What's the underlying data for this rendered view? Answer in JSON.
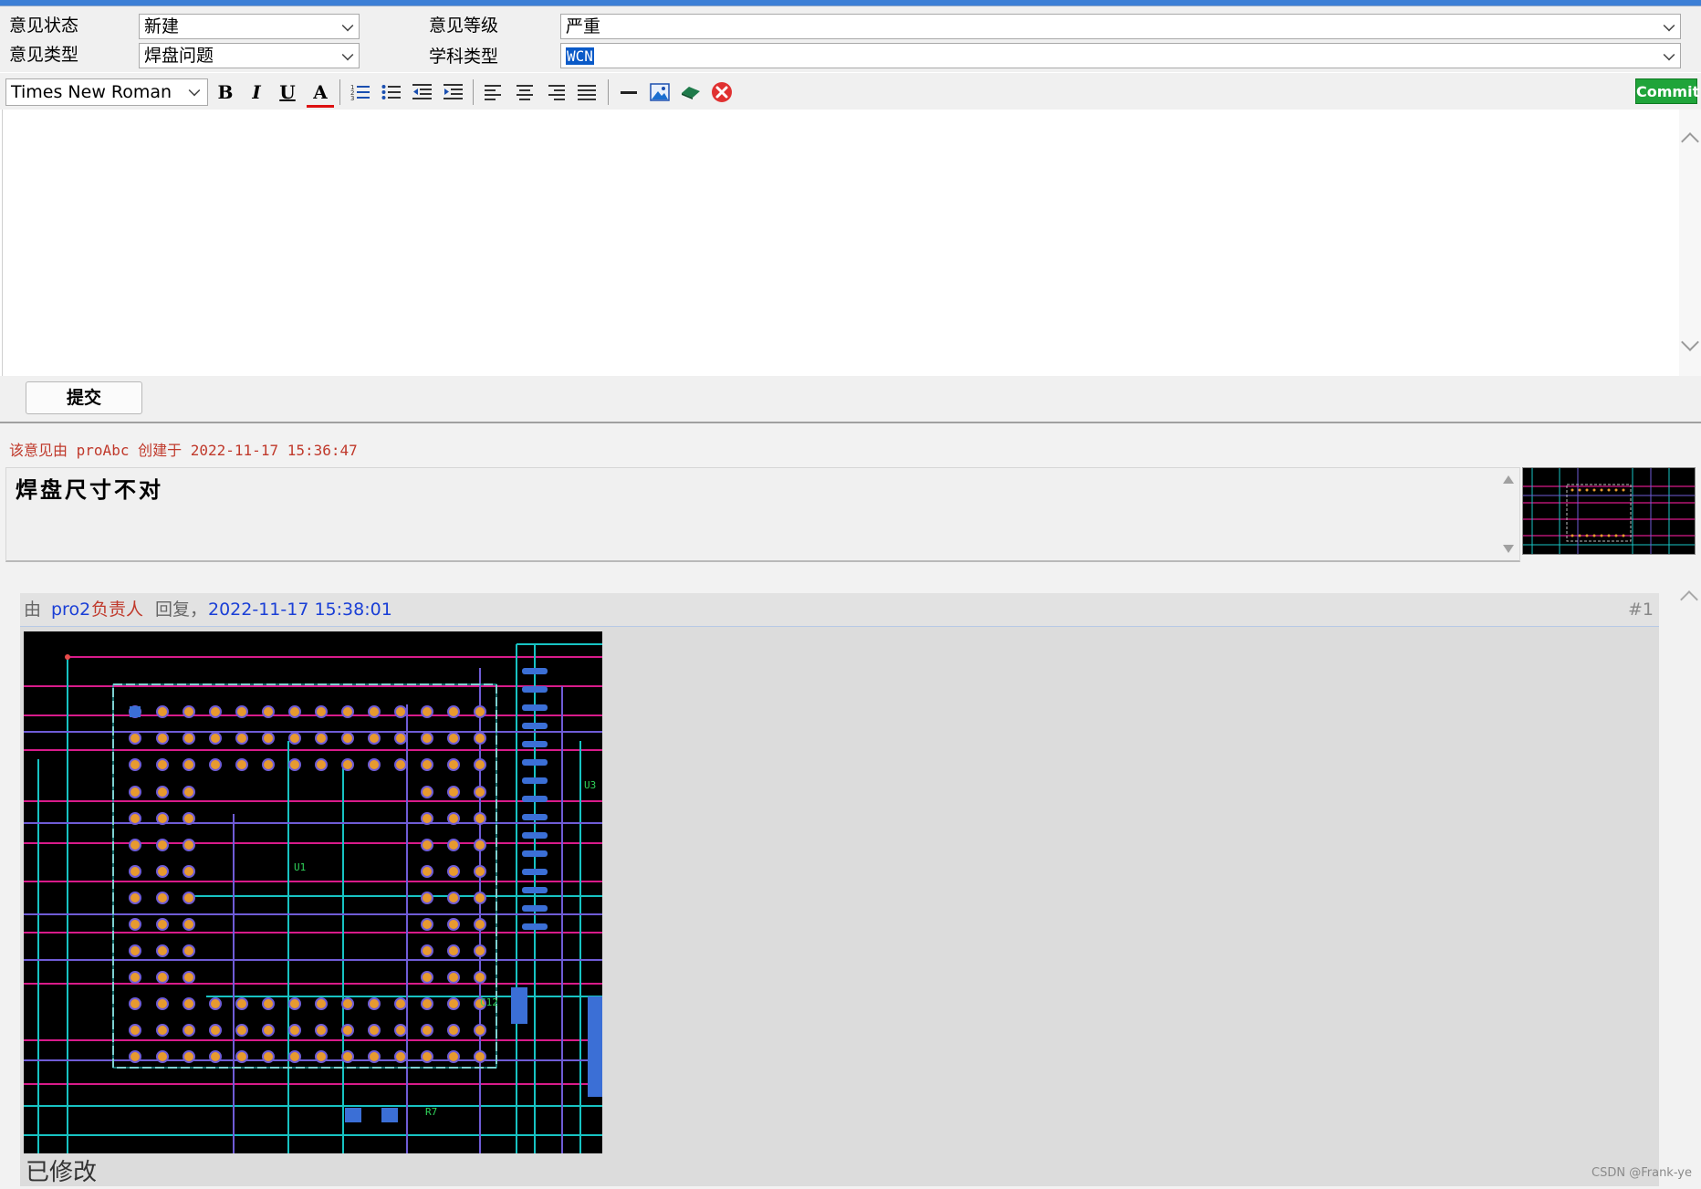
{
  "form": {
    "status_label": "意见状态",
    "status_value": "新建",
    "type_label": "意见类型",
    "type_value": "焊盘问题",
    "level_label": "意见等级",
    "level_value": "严重",
    "discipline_label": "学科类型",
    "discipline_value": "WCN"
  },
  "toolbar": {
    "font_value": "Times New Roman",
    "bold": "B",
    "italic": "I",
    "underline": "U",
    "font_color": "A",
    "commit_label": "Commit"
  },
  "submit": {
    "label": "提交"
  },
  "opinion": {
    "meta_prefix": "该意见由",
    "meta_user": "proAbc",
    "meta_created": "创建于",
    "meta_time": "2022-11-17 15:36:47",
    "content": "焊盘尺寸不对"
  },
  "reply": {
    "by": "由",
    "user": "pro2",
    "role": "负责人",
    "action": "回复，",
    "time": "2022-11-17 15:38:01",
    "index": "#1",
    "text": "已修改"
  },
  "watermark": "CSDN @Frank-ye",
  "colors": {
    "accent": "#3c7fd6",
    "commit": "#1fa43a",
    "meta_red": "#c0392b",
    "link_blue": "#1a3fd6"
  }
}
